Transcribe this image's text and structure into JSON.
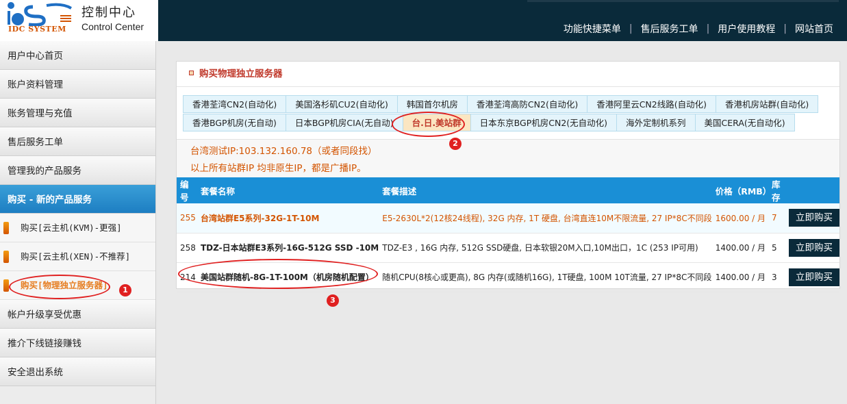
{
  "header": {
    "logo_small": "IDC SYSTEM",
    "title": "控制中心",
    "subtitle": "Control Center",
    "nav": [
      "功能快捷菜单",
      "售后服务工单",
      "用户使用教程",
      "网站首页"
    ]
  },
  "sidebar": {
    "items": [
      {
        "label": "用户中心首页"
      },
      {
        "label": "账户资料管理"
      },
      {
        "label": "账务管理与充值"
      },
      {
        "label": "售后服务工单"
      },
      {
        "label": "管理我的产品服务"
      },
      {
        "label": "购买 - 新的产品服务"
      }
    ],
    "subitems": [
      {
        "label": "购买[云主机(KVM)-更强]"
      },
      {
        "label": "购买[云主机(XEN)-不推荐]"
      },
      {
        "label": "购买[物理独立服务器]"
      }
    ],
    "bottom_items": [
      {
        "label": "帐户升级享受优惠"
      },
      {
        "label": "推介下线链接赚钱"
      },
      {
        "label": "安全退出系统"
      }
    ]
  },
  "panel": {
    "title": "购买物理独立服务器",
    "tabs_row1": [
      "香港荃湾CN2(自动化)",
      "美国洛杉矶CU2(自动化)",
      "韩国首尔机房",
      "香港荃湾高防CN2(自动化)",
      "香港阿里云CN2线路(自动化)",
      "香港机房站群(自动化)"
    ],
    "tabs_row2": [
      "香港BGP机房(无自动)",
      "日本BGP机房CIA(无自动)",
      "台.日.美站群",
      "日本东京BGP机房CN2(无自动化)",
      "海外定制机系列",
      "美国CERA(无自动化)"
    ],
    "notice_line1": "台湾测试IP:103.132.160.78（或者同段找）",
    "notice_line2": "以上所有站群IP 均非原生IP，都是广播IP。",
    "columns": [
      "编号",
      "套餐名称",
      "套餐描述",
      "价格（RMB）",
      "库存",
      ""
    ],
    "rows": [
      {
        "id": "255",
        "name": "台湾站群E5系列-32G-1T-10M",
        "desc": "E5-2630L*2(12核24线程), 32G 内存, 1T 硬盘, 台湾直连10M不限流量, 27 IP*8C不同段",
        "price": "1600.00 / 月",
        "stock": "7",
        "btn": "立即购买"
      },
      {
        "id": "258",
        "name": "TDZ-日本站群E3系列-16G-512G SSD -10M",
        "desc": "TDZ-E3 , 16G 内存, 512G SSD硬盘, 日本软银20M入口,10M出口，1C (253 IP可用)",
        "price": "1400.00 / 月",
        "stock": "5",
        "btn": "立即购买"
      },
      {
        "id": "214",
        "name": "美国站群随机-8G-1T-100M（机房随机配置）",
        "desc": "随机CPU(8核心或更高), 8G 内存(或随机16G), 1T硬盘, 100M 10T流量, 27 IP*8C不同段",
        "price": "1400.00 / 月",
        "stock": "3",
        "btn": "立即购买"
      }
    ]
  },
  "annotations": [
    "1",
    "2",
    "3"
  ]
}
